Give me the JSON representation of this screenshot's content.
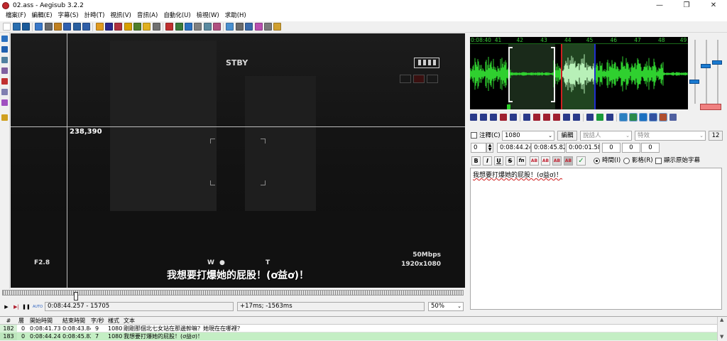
{
  "window": {
    "title": "02.ass - Aegisub 3.2.2",
    "minimize": "—",
    "maximize": "❐",
    "close": "✕"
  },
  "menu": [
    "檔案(F)",
    "編輯(E)",
    "字幕(S)",
    "計時(T)",
    "視訊(V)",
    "音訊(A)",
    "自動化(U)",
    "檢視(W)",
    "求助(H)"
  ],
  "toolbar_colors": [
    "#ffffff",
    "#2a6fb0",
    "#1a5a9a",
    "#3a78c8",
    "#6a6a6a",
    "#c08020",
    "#3060b0",
    "#2a60a0",
    "#2f5fa8",
    "#e09a20",
    "#2a2a90",
    "#b03040",
    "#d8a000",
    "#4f7f2a",
    "#e0b020",
    "#707070",
    "#c03030",
    "#3a7a3a",
    "#2a70c0",
    "#808080",
    "#5a8aa0",
    "#b05080",
    "#4a90d0",
    "#6a6a6a",
    "#3a6aaa",
    "#ba4fb0",
    "#7a7a7a",
    "#d0a030"
  ],
  "side_tool_colors": [
    "#2a70c0",
    "#2060b0",
    "#5080a0",
    "#8060a0",
    "#c03030",
    "#8080b0",
    "#a050c0",
    "#d0a020"
  ],
  "video": {
    "coord": "238,390",
    "stby": "STBY",
    "f_stop": "F2.8",
    "w_label": "W",
    "dot": "●",
    "t_label": "T",
    "bitrate": "50Mbps",
    "resolution": "1920x1080",
    "subtitle": "我想要打爆她的屁股！(ơ益ơ)！"
  },
  "video_controls": {
    "play": "▶",
    "play_line": "▶|",
    "pause": "❚❚",
    "auto": "AUTO",
    "time": "0:08:44.257 - 15705",
    "offset": "+17ms; -1563ms",
    "zoom": "50%"
  },
  "audio": {
    "ruler": [
      {
        "label": "0:08:40",
        "pos": 0
      },
      {
        "label": "41",
        "pos": 0.11
      },
      {
        "label": "42",
        "pos": 0.21
      },
      {
        "label": "43",
        "pos": 0.32
      },
      {
        "label": "44",
        "pos": 0.43
      },
      {
        "label": "45",
        "pos": 0.53
      },
      {
        "label": "46",
        "pos": 0.64
      },
      {
        "label": "47",
        "pos": 0.75
      },
      {
        "label": "48",
        "pos": 0.86
      },
      {
        "label": "49",
        "pos": 0.96
      }
    ],
    "ctrl_colors": [
      "#2a3a8a",
      "#2a3a8a",
      "#2a3a8a",
      "#a02030",
      "#2a3a8a",
      "#2a3a8a",
      "#a02030",
      "#a02030",
      "#a02030",
      "#2a3a8a",
      "#2a3a8a",
      "#2a3a8a",
      "#1a9a3a",
      "#2a3a8a",
      "#2a80c0",
      "#2a8a4a",
      "#1a70c0",
      "#3050a0",
      "#b05030",
      "#5060a0"
    ]
  },
  "edit": {
    "comment_label": "注釋(C)",
    "style": "1080",
    "edit_button": "編輯",
    "actor_placeholder": "說話人",
    "effect_placeholder": "特效",
    "char_count": "12",
    "layer": "0",
    "start_time": "0:08:44.24",
    "end_time": "0:08:45.82",
    "duration": "0:00:01.58",
    "margin_l": "0",
    "margin_r": "0",
    "margin_v": "0",
    "bold": "B",
    "italic": "I",
    "underline": "U",
    "strike": "S",
    "fn": "fn",
    "ab": "AB",
    "check": "✓",
    "time_label": "時間(I)",
    "frame_label": "影格(R)",
    "show_original": "顯示原始字幕",
    "text": "我想要打爆她的屁股！(ơ益ơ)！"
  },
  "grid": {
    "headers": [
      "#",
      "層",
      "開始時間",
      "結束時間",
      "字/秒",
      "樣式",
      "文本"
    ],
    "rows": [
      [
        "182",
        "0",
        "0:08:41.73",
        "0:08:43.84",
        "9",
        "1080",
        "剛剛那個北七女站在那邊幹嘛？她現在在哪裡？"
      ],
      [
        "183",
        "0",
        "0:08:44.24",
        "0:08:45.82",
        "7",
        "1080",
        "我想要打爆她的屁股！(ơ益ơ)！"
      ]
    ]
  }
}
